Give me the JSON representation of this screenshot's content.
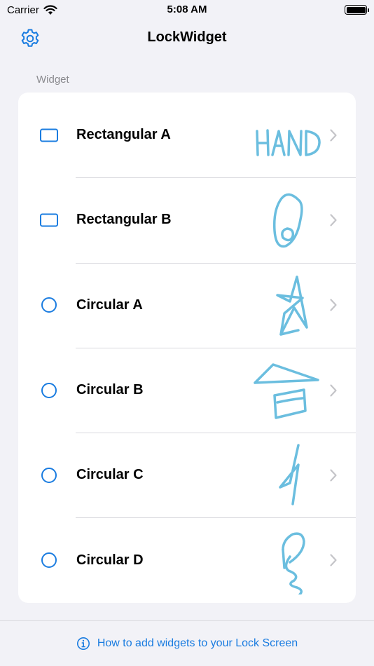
{
  "status_bar": {
    "carrier": "Carrier",
    "time": "5:08 AM"
  },
  "nav": {
    "title": "LockWidget",
    "settings_icon": "gear-icon"
  },
  "section": {
    "header": "Widget"
  },
  "widgets": [
    {
      "label": "Rectangular A",
      "icon": "rectangle-icon",
      "preview": "handwriting-hand"
    },
    {
      "label": "Rectangular B",
      "icon": "rectangle-icon",
      "preview": "handwriting-loop"
    },
    {
      "label": "Circular A",
      "icon": "circle-icon",
      "preview": "handwriting-star"
    },
    {
      "label": "Circular B",
      "icon": "circle-icon",
      "preview": "handwriting-house"
    },
    {
      "label": "Circular C",
      "icon": "circle-icon",
      "preview": "handwriting-bolt"
    },
    {
      "label": "Circular D",
      "icon": "circle-icon",
      "preview": "handwriting-squiggle"
    }
  ],
  "footer": {
    "link": "How to add widgets to your Lock Screen",
    "icon": "info-icon"
  },
  "colors": {
    "accent": "#1A7CE0",
    "sketch": "#5BB7DC",
    "background": "#F2F2F7"
  }
}
